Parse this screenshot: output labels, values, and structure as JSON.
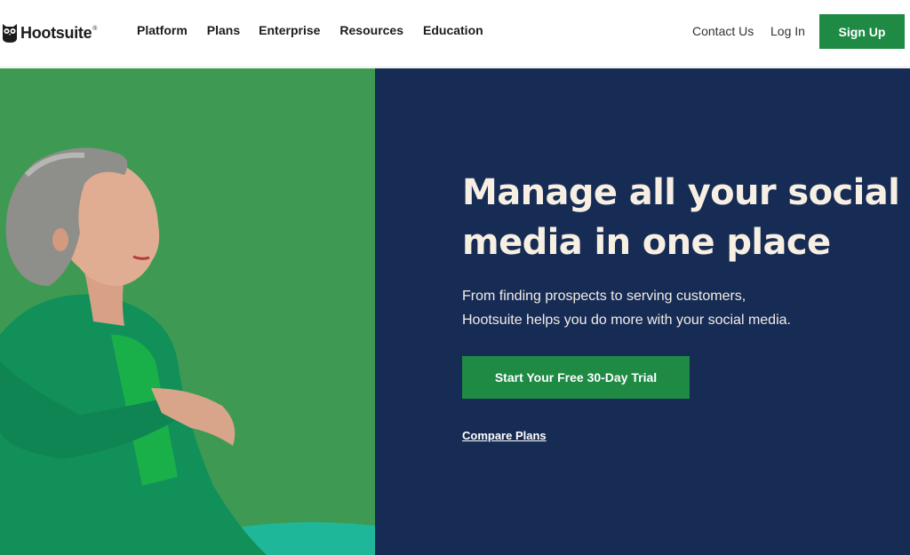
{
  "header": {
    "logo_text": "Hootsuite",
    "logo_mark": "®",
    "nav": [
      {
        "label": "Platform"
      },
      {
        "label": "Plans"
      },
      {
        "label": "Enterprise"
      },
      {
        "label": "Resources"
      },
      {
        "label": "Education"
      }
    ],
    "contact_label": "Contact Us",
    "login_label": "Log In",
    "signup_label": "Sign Up"
  },
  "hero": {
    "headline_line1": "Manage all your social",
    "headline_line2": "media in one place",
    "subtext_line1": "From finding prospects to serving customers,",
    "subtext_line2": "Hootsuite helps you do more with your social media.",
    "cta_label": "Start Your Free 30-Day Trial",
    "secondary_link": "Compare Plans"
  },
  "colors": {
    "brand_green": "#1e8a44",
    "navy": "#172c55",
    "photo_green": "#3e9a52",
    "headline_cream": "#f8efe3"
  },
  "icons": {
    "logo": "owl-icon"
  }
}
